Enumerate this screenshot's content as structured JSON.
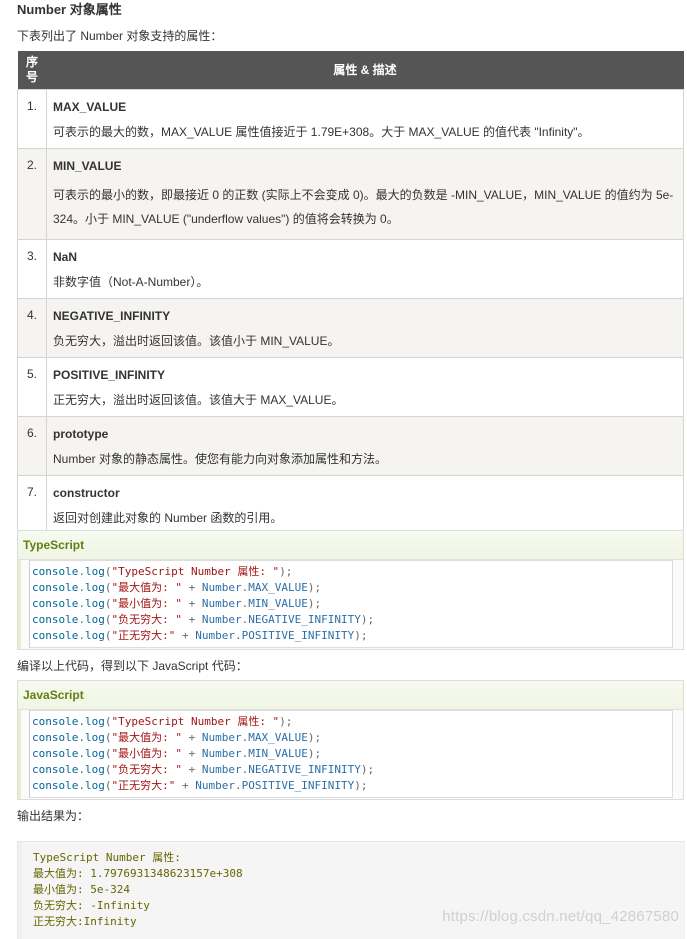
{
  "heading": "Number 对象属性",
  "intro": "下表列出了 Number 对象支持的属性：",
  "table": {
    "col_num": "序号",
    "col_desc": "属性 & 描述",
    "rows": [
      {
        "num": "1.",
        "name": "MAX_VALUE",
        "desc": "可表示的最大的数，MAX_VALUE 属性值接近于 1.79E+308。大于 MAX_VALUE 的值代表 \"Infinity\"。"
      },
      {
        "num": "2.",
        "name": "MIN_VALUE",
        "desc": "可表示的最小的数，即最接近 0 的正数 (实际上不会变成 0)。最大的负数是 -MIN_VALUE，MIN_VALUE 的值约为 5e-324。小于 MIN_VALUE (\"underflow values\") 的值将会转换为 0。"
      },
      {
        "num": "3.",
        "name": "NaN",
        "desc": "非数字值（Not-A-Number）。"
      },
      {
        "num": "4.",
        "name": "NEGATIVE_INFINITY",
        "desc": "负无穷大，溢出时返回该值。该值小于 MIN_VALUE。"
      },
      {
        "num": "5.",
        "name": "POSITIVE_INFINITY",
        "desc": "正无穷大，溢出时返回该值。该值大于 MAX_VALUE。"
      },
      {
        "num": "6.",
        "name": "prototype",
        "desc": "Number 对象的静态属性。使您有能力向对象添加属性和方法。"
      },
      {
        "num": "7.",
        "name": "constructor",
        "desc": "返回对创建此对象的 Number 函数的引用。"
      }
    ]
  },
  "typescript_block": {
    "label": "TypeScript",
    "lines": [
      "console.log(\"TypeScript Number 属性: \");",
      "console.log(\"最大值为: \" + Number.MAX_VALUE);",
      "console.log(\"最小值为: \" + Number.MIN_VALUE);",
      "console.log(\"负无穷大: \" + Number.NEGATIVE_INFINITY);",
      "console.log(\"正无穷大:\" + Number.POSITIVE_INFINITY);"
    ]
  },
  "compile_note": "编译以上代码，得到以下 JavaScript 代码：",
  "javascript_block": {
    "label": "JavaScript",
    "lines": [
      "console.log(\"TypeScript Number 属性: \");",
      "console.log(\"最大值为: \" + Number.MAX_VALUE);",
      "console.log(\"最小值为: \" + Number.MIN_VALUE);",
      "console.log(\"负无穷大: \" + Number.NEGATIVE_INFINITY);",
      "console.log(\"正无穷大:\" + Number.POSITIVE_INFINITY);"
    ]
  },
  "output_note": "输出结果为：",
  "output_lines": [
    "TypeScript Number 属性:",
    "最大值为: 1.7976931348623157e+308",
    "最小值为: 5e-324",
    "负无穷大: -Infinity",
    "正无穷大:Infinity"
  ],
  "watermark": "https://blog.csdn.net/qq_42867580"
}
